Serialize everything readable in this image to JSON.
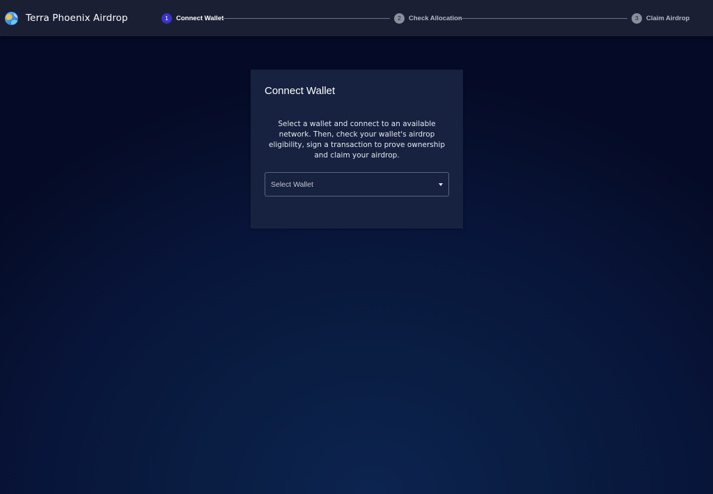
{
  "header": {
    "app_title": "Terra Phoenix Airdrop",
    "logo_icon": "terra-globe-icon"
  },
  "stepper": {
    "steps": [
      {
        "number": "1",
        "label": "Connect Wallet",
        "state": "active"
      },
      {
        "number": "2",
        "label": "Check Allocation",
        "state": "inactive"
      },
      {
        "number": "3",
        "label": "Claim Airdrop",
        "state": "inactive"
      }
    ]
  },
  "card": {
    "title": "Connect Wallet",
    "description": "Select a wallet and connect to an available network. Then, check your wallet's airdrop eligibility, sign a transaction to prove ownership and claim your airdrop.",
    "wallet_select": {
      "placeholder": "Select Wallet"
    }
  },
  "colors": {
    "active_step": "#3a33c9",
    "topbar": "#1a1f33",
    "card": "#172240"
  }
}
